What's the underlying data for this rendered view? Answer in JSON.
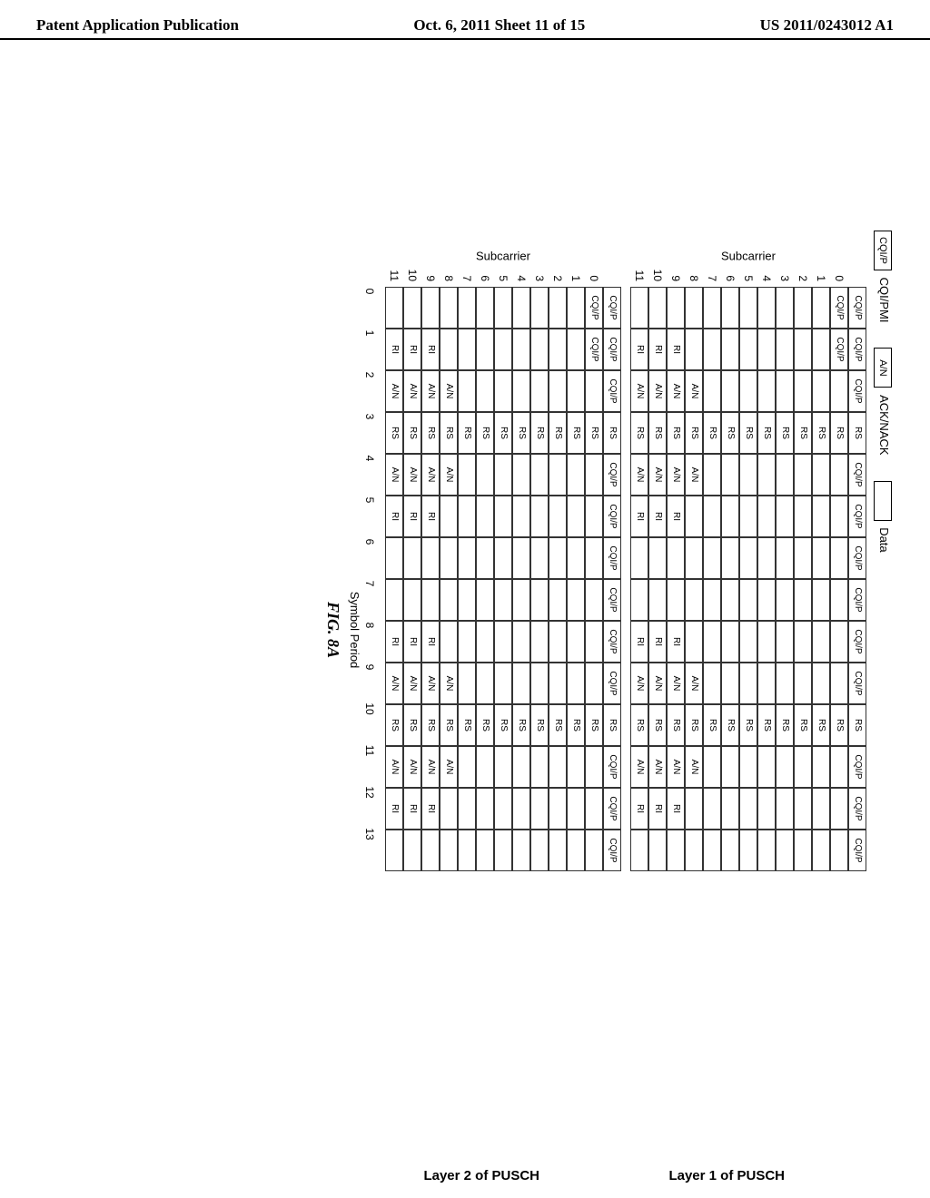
{
  "header": {
    "left": "Patent Application Publication",
    "center": "Oct. 6, 2011   Sheet 11 of 15",
    "right": "US 2011/0243012 A1"
  },
  "legend": {
    "cqip": "CQI/P",
    "cqip_label": "CQI/PMI",
    "an": "A/N",
    "an_label": "ACK/NACK",
    "data_label": "Data"
  },
  "grids": [
    {
      "title": "Layer 1 of PUSCH"
    },
    {
      "title": "Layer 2 of PUSCH"
    }
  ],
  "axes": {
    "y": "Subcarrier",
    "x": "Symbol Period"
  },
  "caption": "FIG. 8A",
  "chart_data": [
    {
      "type": "table",
      "title": "Layer 1 of PUSCH",
      "xlabel": "Symbol Period",
      "ylabel": "Subcarrier",
      "x_ticks": [
        0,
        1,
        2,
        3,
        4,
        5,
        6,
        7,
        8,
        9,
        10,
        11,
        12,
        13
      ],
      "y_ticks": [
        0,
        1,
        2,
        3,
        4,
        5,
        6,
        7,
        8,
        9,
        10,
        11
      ],
      "header_row": [
        "CQI/P",
        "CQI/P",
        "CQI/P",
        "RS",
        "CQI/P",
        "CQI/P",
        "CQI/P",
        "CQI/P",
        "CQI/P",
        "CQI/P",
        "RS",
        "CQI/P",
        "CQI/P",
        "CQI/P"
      ],
      "rows": [
        [
          "CQI/P",
          "CQI/P",
          "",
          "RS",
          "",
          "",
          "",
          "",
          "",
          "",
          "RS",
          "",
          "",
          ""
        ],
        [
          "",
          "",
          "",
          "RS",
          "",
          "",
          "",
          "",
          "",
          "",
          "RS",
          "",
          "",
          ""
        ],
        [
          "",
          "",
          "",
          "RS",
          "",
          "",
          "",
          "",
          "",
          "",
          "RS",
          "",
          "",
          ""
        ],
        [
          "",
          "",
          "",
          "RS",
          "",
          "",
          "",
          "",
          "",
          "",
          "RS",
          "",
          "",
          ""
        ],
        [
          "",
          "",
          "",
          "RS",
          "",
          "",
          "",
          "",
          "",
          "",
          "RS",
          "",
          "",
          ""
        ],
        [
          "",
          "",
          "",
          "RS",
          "",
          "",
          "",
          "",
          "",
          "",
          "RS",
          "",
          "",
          ""
        ],
        [
          "",
          "",
          "",
          "RS",
          "",
          "",
          "",
          "",
          "",
          "",
          "RS",
          "",
          "",
          ""
        ],
        [
          "",
          "",
          "",
          "RS",
          "",
          "",
          "",
          "",
          "",
          "",
          "RS",
          "",
          "",
          ""
        ],
        [
          "",
          "",
          "A/N",
          "RS",
          "A/N",
          "",
          "",
          "",
          "",
          "A/N",
          "RS",
          "A/N",
          "",
          ""
        ],
        [
          "",
          "RI",
          "A/N",
          "RS",
          "A/N",
          "RI",
          "",
          "",
          "RI",
          "A/N",
          "RS",
          "A/N",
          "RI",
          ""
        ],
        [
          "",
          "RI",
          "A/N",
          "RS",
          "A/N",
          "RI",
          "",
          "",
          "RI",
          "A/N",
          "RS",
          "A/N",
          "RI",
          ""
        ],
        [
          "",
          "RI",
          "A/N",
          "RS",
          "A/N",
          "RI",
          "",
          "",
          "RI",
          "A/N",
          "RS",
          "A/N",
          "RI",
          ""
        ]
      ]
    },
    {
      "type": "table",
      "title": "Layer 2 of PUSCH",
      "xlabel": "Symbol Period",
      "ylabel": "Subcarrier",
      "x_ticks": [
        0,
        1,
        2,
        3,
        4,
        5,
        6,
        7,
        8,
        9,
        10,
        11,
        12,
        13
      ],
      "y_ticks": [
        0,
        1,
        2,
        3,
        4,
        5,
        6,
        7,
        8,
        9,
        10,
        11
      ],
      "header_row": [
        "CQI/P",
        "CQI/P",
        "CQI/P",
        "RS",
        "CQI/P",
        "CQI/P",
        "CQI/P",
        "CQI/P",
        "CQI/P",
        "CQI/P",
        "RS",
        "CQI/P",
        "CQI/P",
        "CQI/P"
      ],
      "rows": [
        [
          "CQI/P",
          "CQI/P",
          "",
          "RS",
          "",
          "",
          "",
          "",
          "",
          "",
          "RS",
          "",
          "",
          ""
        ],
        [
          "",
          "",
          "",
          "RS",
          "",
          "",
          "",
          "",
          "",
          "",
          "RS",
          "",
          "",
          ""
        ],
        [
          "",
          "",
          "",
          "RS",
          "",
          "",
          "",
          "",
          "",
          "",
          "RS",
          "",
          "",
          ""
        ],
        [
          "",
          "",
          "",
          "RS",
          "",
          "",
          "",
          "",
          "",
          "",
          "RS",
          "",
          "",
          ""
        ],
        [
          "",
          "",
          "",
          "RS",
          "",
          "",
          "",
          "",
          "",
          "",
          "RS",
          "",
          "",
          ""
        ],
        [
          "",
          "",
          "",
          "RS",
          "",
          "",
          "",
          "",
          "",
          "",
          "RS",
          "",
          "",
          ""
        ],
        [
          "",
          "",
          "",
          "RS",
          "",
          "",
          "",
          "",
          "",
          "",
          "RS",
          "",
          "",
          ""
        ],
        [
          "",
          "",
          "",
          "RS",
          "",
          "",
          "",
          "",
          "",
          "",
          "RS",
          "",
          "",
          ""
        ],
        [
          "",
          "",
          "A/N",
          "RS",
          "A/N",
          "",
          "",
          "",
          "",
          "A/N",
          "RS",
          "A/N",
          "",
          ""
        ],
        [
          "",
          "RI",
          "A/N",
          "RS",
          "A/N",
          "RI",
          "",
          "",
          "RI",
          "A/N",
          "RS",
          "A/N",
          "RI",
          ""
        ],
        [
          "",
          "RI",
          "A/N",
          "RS",
          "A/N",
          "RI",
          "",
          "",
          "RI",
          "A/N",
          "RS",
          "A/N",
          "RI",
          ""
        ],
        [
          "",
          "RI",
          "A/N",
          "RS",
          "A/N",
          "RI",
          "",
          "",
          "RI",
          "A/N",
          "RS",
          "A/N",
          "RI",
          ""
        ]
      ]
    }
  ]
}
